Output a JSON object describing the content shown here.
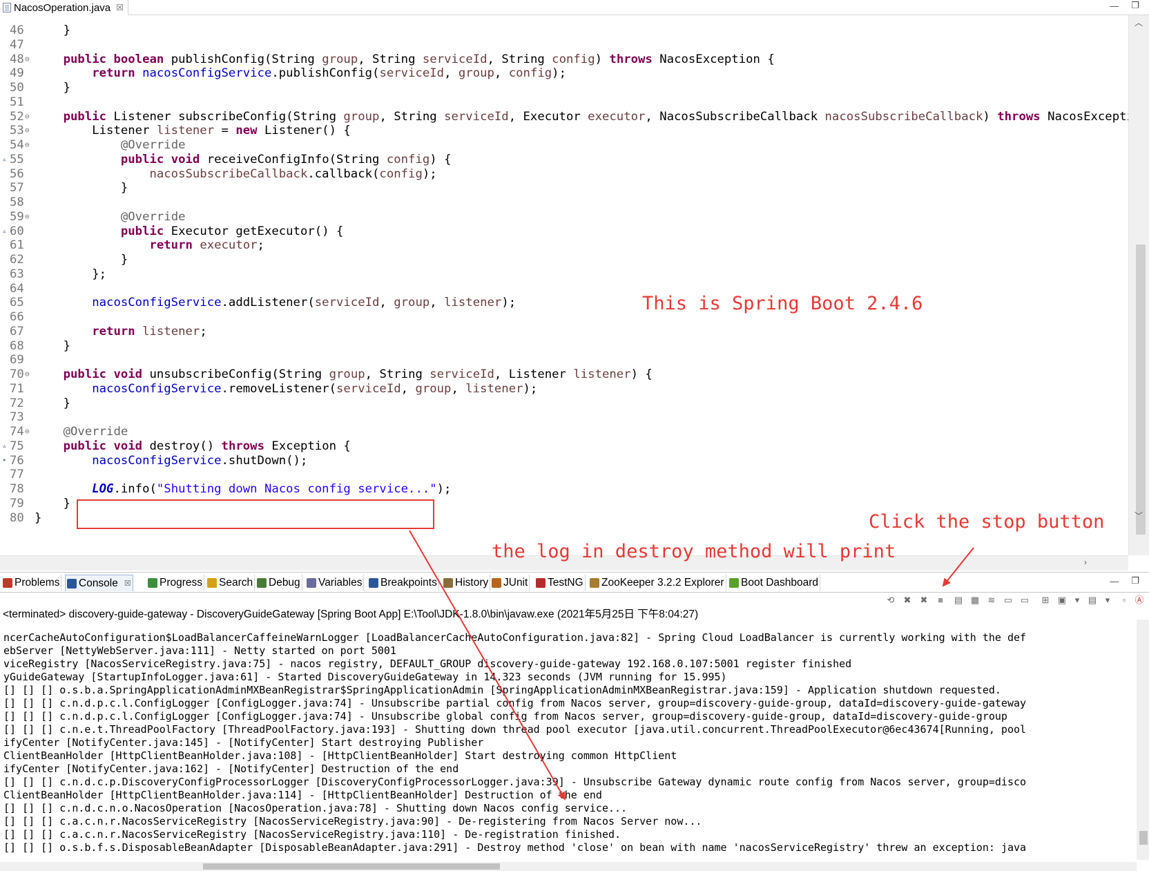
{
  "editor": {
    "tab_label": "NacosOperation.java",
    "tab_close": "☒",
    "window_buttons": {
      "minimize": "—",
      "maximize": "❐"
    },
    "lines": [
      {
        "n": "46",
        "fold": "",
        "ovr": "",
        "segs": [
          [
            "p",
            "    }"
          ]
        ]
      },
      {
        "n": "47",
        "fold": "",
        "ovr": "",
        "segs": []
      },
      {
        "n": "48",
        "fold": "⊖",
        "ovr": "",
        "segs": [
          [
            "p",
            "    "
          ],
          [
            "kw",
            "public"
          ],
          [
            "p",
            " "
          ],
          [
            "kw",
            "boolean"
          ],
          [
            "p",
            " publishConfig(String "
          ],
          [
            "v",
            "group"
          ],
          [
            "p",
            ", String "
          ],
          [
            "v",
            "serviceId"
          ],
          [
            "p",
            ", String "
          ],
          [
            "v",
            "config"
          ],
          [
            "p",
            ") "
          ],
          [
            "kw",
            "throws"
          ],
          [
            "p",
            " NacosException {"
          ]
        ]
      },
      {
        "n": "49",
        "fold": "",
        "ovr": "",
        "segs": [
          [
            "p",
            "        "
          ],
          [
            "kw",
            "return"
          ],
          [
            "p",
            " "
          ],
          [
            "f",
            "nacosConfigService"
          ],
          [
            "p",
            ".publishConfig("
          ],
          [
            "v",
            "serviceId"
          ],
          [
            "p",
            ", "
          ],
          [
            "v",
            "group"
          ],
          [
            "p",
            ", "
          ],
          [
            "v",
            "config"
          ],
          [
            "p",
            ");"
          ]
        ]
      },
      {
        "n": "50",
        "fold": "",
        "ovr": "",
        "segs": [
          [
            "p",
            "    }"
          ]
        ]
      },
      {
        "n": "51",
        "fold": "",
        "ovr": "",
        "segs": []
      },
      {
        "n": "52",
        "fold": "⊖",
        "ovr": "",
        "segs": [
          [
            "p",
            "    "
          ],
          [
            "kw",
            "public"
          ],
          [
            "p",
            " Listener subscribeConfig(String "
          ],
          [
            "v",
            "group"
          ],
          [
            "p",
            ", String "
          ],
          [
            "v",
            "serviceId"
          ],
          [
            "p",
            ", Executor "
          ],
          [
            "v",
            "executor"
          ],
          [
            "p",
            ", NacosSubscribeCallback "
          ],
          [
            "v",
            "nacosSubscribeCallback"
          ],
          [
            "p",
            ") "
          ],
          [
            "kw",
            "throws"
          ],
          [
            "p",
            " NacosException {"
          ]
        ]
      },
      {
        "n": "53",
        "fold": "⊖",
        "ovr": "",
        "segs": [
          [
            "p",
            "        Listener "
          ],
          [
            "v",
            "listener"
          ],
          [
            "p",
            " = "
          ],
          [
            "kw",
            "new"
          ],
          [
            "p",
            " Listener() {"
          ]
        ]
      },
      {
        "n": "54",
        "fold": "⊖",
        "ovr": "",
        "segs": [
          [
            "p",
            "            "
          ],
          [
            "a",
            "@Override"
          ]
        ]
      },
      {
        "n": "55",
        "fold": "",
        "ovr": "▵",
        "segs": [
          [
            "p",
            "            "
          ],
          [
            "kw",
            "public"
          ],
          [
            "p",
            " "
          ],
          [
            "kw",
            "void"
          ],
          [
            "p",
            " receiveConfigInfo(String "
          ],
          [
            "v",
            "config"
          ],
          [
            "p",
            ") {"
          ]
        ]
      },
      {
        "n": "56",
        "fold": "",
        "ovr": "",
        "segs": [
          [
            "p",
            "                "
          ],
          [
            "v",
            "nacosSubscribeCallback"
          ],
          [
            "p",
            ".callback("
          ],
          [
            "v",
            "config"
          ],
          [
            "p",
            ");"
          ]
        ]
      },
      {
        "n": "57",
        "fold": "",
        "ovr": "",
        "segs": [
          [
            "p",
            "            }"
          ]
        ]
      },
      {
        "n": "58",
        "fold": "",
        "ovr": "",
        "segs": []
      },
      {
        "n": "59",
        "fold": "⊖",
        "ovr": "",
        "segs": [
          [
            "p",
            "            "
          ],
          [
            "a",
            "@Override"
          ]
        ]
      },
      {
        "n": "60",
        "fold": "",
        "ovr": "▵",
        "segs": [
          [
            "p",
            "            "
          ],
          [
            "kw",
            "public"
          ],
          [
            "p",
            " Executor getExecutor() {"
          ]
        ]
      },
      {
        "n": "61",
        "fold": "",
        "ovr": "",
        "segs": [
          [
            "p",
            "                "
          ],
          [
            "kw",
            "return"
          ],
          [
            "p",
            " "
          ],
          [
            "v",
            "executor"
          ],
          [
            "p",
            ";"
          ]
        ]
      },
      {
        "n": "62",
        "fold": "",
        "ovr": "",
        "segs": [
          [
            "p",
            "            }"
          ]
        ]
      },
      {
        "n": "63",
        "fold": "",
        "ovr": "",
        "segs": [
          [
            "p",
            "        };"
          ]
        ]
      },
      {
        "n": "64",
        "fold": "",
        "ovr": "",
        "segs": []
      },
      {
        "n": "65",
        "fold": "",
        "ovr": "",
        "segs": [
          [
            "p",
            "        "
          ],
          [
            "f",
            "nacosConfigService"
          ],
          [
            "p",
            ".addListener("
          ],
          [
            "v",
            "serviceId"
          ],
          [
            "p",
            ", "
          ],
          [
            "v",
            "group"
          ],
          [
            "p",
            ", "
          ],
          [
            "v",
            "listener"
          ],
          [
            "p",
            ");"
          ]
        ]
      },
      {
        "n": "66",
        "fold": "",
        "ovr": "",
        "segs": []
      },
      {
        "n": "67",
        "fold": "",
        "ovr": "",
        "segs": [
          [
            "p",
            "        "
          ],
          [
            "kw",
            "return"
          ],
          [
            "p",
            " "
          ],
          [
            "v",
            "listener"
          ],
          [
            "p",
            ";"
          ]
        ]
      },
      {
        "n": "68",
        "fold": "",
        "ovr": "",
        "segs": [
          [
            "p",
            "    }"
          ]
        ]
      },
      {
        "n": "69",
        "fold": "",
        "ovr": "",
        "segs": []
      },
      {
        "n": "70",
        "fold": "⊖",
        "ovr": "",
        "segs": [
          [
            "p",
            "    "
          ],
          [
            "kw",
            "public"
          ],
          [
            "p",
            " "
          ],
          [
            "kw",
            "void"
          ],
          [
            "p",
            " unsubscribeConfig(String "
          ],
          [
            "v",
            "group"
          ],
          [
            "p",
            ", String "
          ],
          [
            "v",
            "serviceId"
          ],
          [
            "p",
            ", Listener "
          ],
          [
            "v",
            "listener"
          ],
          [
            "p",
            ") {"
          ]
        ]
      },
      {
        "n": "71",
        "fold": "",
        "ovr": "",
        "segs": [
          [
            "p",
            "        "
          ],
          [
            "f",
            "nacosConfigService"
          ],
          [
            "p",
            ".removeListener("
          ],
          [
            "v",
            "serviceId"
          ],
          [
            "p",
            ", "
          ],
          [
            "v",
            "group"
          ],
          [
            "p",
            ", "
          ],
          [
            "v",
            "listener"
          ],
          [
            "p",
            ");"
          ]
        ]
      },
      {
        "n": "72",
        "fold": "",
        "ovr": "",
        "segs": [
          [
            "p",
            "    }"
          ]
        ]
      },
      {
        "n": "73",
        "fold": "",
        "ovr": "",
        "segs": []
      },
      {
        "n": "74",
        "fold": "⊖",
        "ovr": "",
        "segs": [
          [
            "p",
            "    "
          ],
          [
            "a",
            "@Override"
          ]
        ]
      },
      {
        "n": "75",
        "fold": "",
        "ovr": "▵",
        "segs": [
          [
            "p",
            "    "
          ],
          [
            "kw",
            "public"
          ],
          [
            "p",
            " "
          ],
          [
            "kw",
            "void"
          ],
          [
            "p",
            " destroy() "
          ],
          [
            "kw",
            "throws"
          ],
          [
            "p",
            " Exception {"
          ]
        ]
      },
      {
        "n": "76",
        "fold": "",
        "ovr": "•",
        "segs": [
          [
            "p",
            "        "
          ],
          [
            "f",
            "nacosConfigService"
          ],
          [
            "p",
            ".shutDown();"
          ]
        ]
      },
      {
        "n": "77",
        "fold": "",
        "ovr": "",
        "segs": []
      },
      {
        "n": "78",
        "fold": "",
        "ovr": "",
        "segs": [
          [
            "p",
            "        "
          ],
          [
            "log",
            "LOG"
          ],
          [
            "p",
            ".info("
          ],
          [
            "s",
            "\"Shutting down Nacos config service...\""
          ],
          [
            "p",
            ");"
          ]
        ]
      },
      {
        "n": "79",
        "fold": "",
        "ovr": "",
        "segs": [
          [
            "p",
            "    }"
          ]
        ]
      },
      {
        "n": "80",
        "fold": "",
        "ovr": "",
        "segs": [
          [
            "p",
            "}"
          ]
        ]
      }
    ]
  },
  "annotations": {
    "spring_boot": "This is Spring Boot 2.4.6",
    "stop_button": "Click the stop button",
    "log_print": "the log in destroy method will print",
    "color": "#e53935"
  },
  "views": {
    "tabs": [
      {
        "label": "Problems",
        "icon": "problems-icon",
        "color": "#c0392b"
      },
      {
        "label": "Console",
        "icon": "console-icon",
        "color": "#2b5797",
        "active": true,
        "close": "☒"
      },
      {
        "label": "Progress",
        "icon": "progress-icon",
        "color": "#3d8f3d"
      },
      {
        "label": "Search",
        "icon": "search-icon",
        "color": "#d4a017"
      },
      {
        "label": "Debug",
        "icon": "debug-icon",
        "color": "#4a7a3a"
      },
      {
        "label": "Variables",
        "icon": "variables-icon",
        "color": "#6b6b9e"
      },
      {
        "label": "Breakpoints",
        "icon": "breakpoints-icon",
        "color": "#2b5797"
      },
      {
        "label": "History",
        "icon": "history-icon",
        "color": "#8a6d3b"
      },
      {
        "label": "JUnit",
        "icon": "junit-icon",
        "color": "#b5651d"
      },
      {
        "label": "TestNG",
        "icon": "testng-icon",
        "color": "#b32d2d"
      },
      {
        "label": "ZooKeeper 3.2.2 Explorer",
        "icon": "zookeeper-icon",
        "color": "#a67c2e"
      },
      {
        "label": "Boot Dashboard",
        "icon": "boot-dashboard-icon",
        "color": "#5aa02c"
      }
    ],
    "window_buttons": {
      "minimize": "—",
      "maximize": "❐"
    }
  },
  "console": {
    "header": "<terminated> discovery-guide-gateway - DiscoveryGuideGateway [Spring Boot App] E:\\Tool\\JDK-1.8.0\\bin\\javaw.exe (2021年5月25日 下午8:04:27)",
    "toolbar_icons": [
      "pin-icon",
      "terminate-icon",
      "remove-all-terminated-icon",
      "stop-icon",
      "clear-console-icon",
      "scroll-lock-icon",
      "word-wrap-icon",
      "show-stdout-icon",
      "show-stderr-icon",
      "pin-console-icon",
      "display-selected-console-icon",
      "dropdown-icon",
      "open-console-icon",
      "dropdown-icon",
      "minimize-icon",
      "maximize-icon"
    ],
    "lines": [
      "ncerCacheAutoConfiguration$LoadBalancerCaffeineWarnLogger [LoadBalancerCacheAutoConfiguration.java:82] - Spring Cloud LoadBalancer is currently working with the def",
      "ebServer [NettyWebServer.java:111] - Netty started on port 5001",
      "viceRegistry [NacosServiceRegistry.java:75] - nacos registry, DEFAULT_GROUP discovery-guide-gateway 192.168.0.107:5001 register finished",
      "yGuideGateway [StartupInfoLogger.java:61] - Started DiscoveryGuideGateway in 14.323 seconds (JVM running for 15.995)",
      "[] [] [] o.s.b.a.SpringApplicationAdminMXBeanRegistrar$SpringApplicationAdmin [SpringApplicationAdminMXBeanRegistrar.java:159] - Application shutdown requested.",
      "[] [] [] c.n.d.p.c.l.ConfigLogger [ConfigLogger.java:74] - Unsubscribe partial config from Nacos server, group=discovery-guide-group, dataId=discovery-guide-gateway",
      "[] [] [] c.n.d.p.c.l.ConfigLogger [ConfigLogger.java:74] - Unsubscribe global config from Nacos server, group=discovery-guide-group, dataId=discovery-guide-group",
      "[] [] [] c.n.e.t.ThreadPoolFactory [ThreadPoolFactory.java:193] - Shutting down thread pool executor [java.util.concurrent.ThreadPoolExecutor@6ec43674[Running, pool",
      "ifyCenter [NotifyCenter.java:145] - [NotifyCenter] Start destroying Publisher",
      "ClientBeanHolder [HttpClientBeanHolder.java:108] - [HttpClientBeanHolder] Start destroying common HttpClient",
      "ifyCenter [NotifyCenter.java:162] - [NotifyCenter] Destruction of the end",
      "[] [] [] c.n.d.c.p.DiscoveryConfigProcessorLogger [DiscoveryConfigProcessorLogger.java:39] - Unsubscribe Gateway dynamic route config from Nacos server, group=disco",
      "ClientBeanHolder [HttpClientBeanHolder.java:114] - [HttpClientBeanHolder] Destruction of the end",
      "[] [] [] c.n.d.c.n.o.NacosOperation [NacosOperation.java:78] - Shutting down Nacos config service...",
      "[] [] [] c.a.c.n.r.NacosServiceRegistry [NacosServiceRegistry.java:90] - De-registering from Nacos Server now...",
      "[] [] [] c.a.c.n.r.NacosServiceRegistry [NacosServiceRegistry.java:110] - De-registration finished.",
      "[] [] [] o.s.b.f.s.DisposableBeanAdapter [DisposableBeanAdapter.java:291] - Destroy method 'close' on bean with name 'nacosServiceRegistry' threw an exception: java"
    ]
  }
}
